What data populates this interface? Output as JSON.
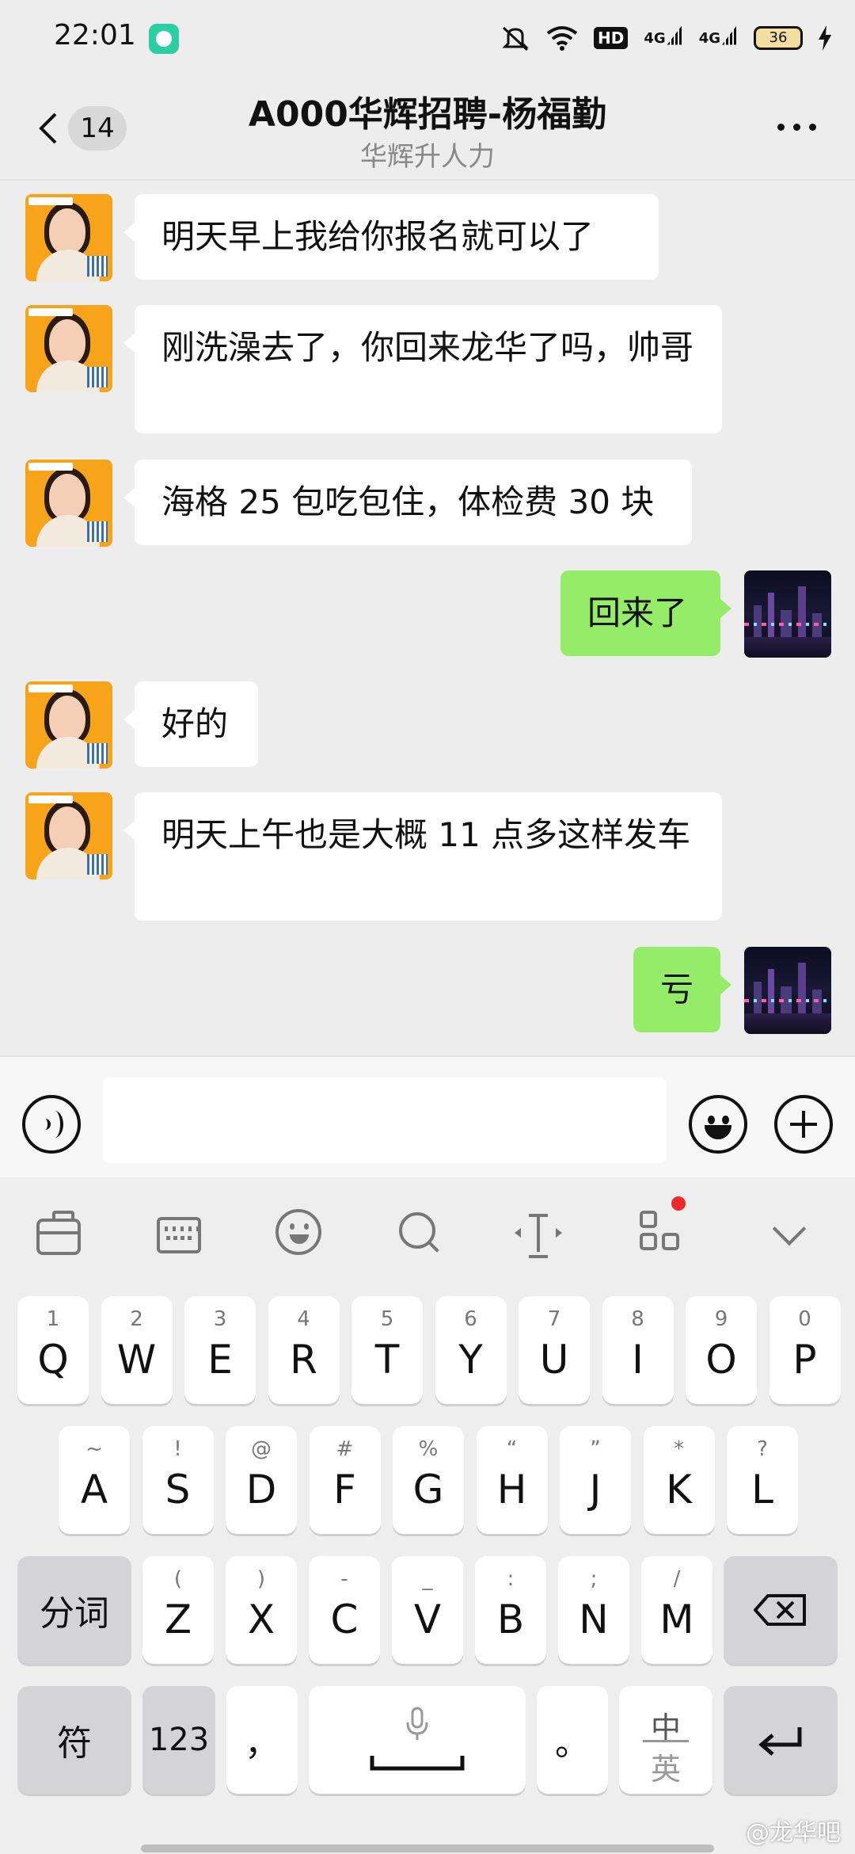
{
  "status_bar": {
    "time": "22:01",
    "hd": "HD",
    "net1": "4G",
    "net2": "4G",
    "battery": "36"
  },
  "header": {
    "unread_count": "14",
    "title": "A000华辉招聘-杨福勤",
    "subtitle": "华辉升人力"
  },
  "messages": [
    {
      "from": "recruiter",
      "text": "明天早上我给你报名就可以了"
    },
    {
      "from": "recruiter",
      "text": "刚洗澡去了，你回来龙华了吗，帅哥"
    },
    {
      "from": "recruiter",
      "text": "海格 25 包吃包住，体检费 30 块"
    },
    {
      "from": "self",
      "text": "回来了"
    },
    {
      "from": "recruiter",
      "text": "好的"
    },
    {
      "from": "recruiter",
      "text": "明天上午也是大概 11 点多这样发车"
    },
    {
      "from": "self",
      "text": "亏"
    }
  ],
  "input": {
    "value": "",
    "placeholder": ""
  },
  "keyboard": {
    "row1": [
      {
        "top": "1",
        "main": "Q"
      },
      {
        "top": "2",
        "main": "W"
      },
      {
        "top": "3",
        "main": "E"
      },
      {
        "top": "4",
        "main": "R"
      },
      {
        "top": "5",
        "main": "T"
      },
      {
        "top": "6",
        "main": "Y"
      },
      {
        "top": "7",
        "main": "U"
      },
      {
        "top": "8",
        "main": "I"
      },
      {
        "top": "9",
        "main": "O"
      },
      {
        "top": "0",
        "main": "P"
      }
    ],
    "row2": [
      {
        "top": "~",
        "main": "A"
      },
      {
        "top": "!",
        "main": "S"
      },
      {
        "top": "@",
        "main": "D"
      },
      {
        "top": "#",
        "main": "F"
      },
      {
        "top": "%",
        "main": "G"
      },
      {
        "top": "“",
        "main": "H"
      },
      {
        "top": "”",
        "main": "J"
      },
      {
        "top": "*",
        "main": "K"
      },
      {
        "top": "?",
        "main": "L"
      }
    ],
    "row3": [
      {
        "top": "(",
        "main": "Z"
      },
      {
        "top": ")",
        "main": "X"
      },
      {
        "top": "-",
        "main": "C"
      },
      {
        "top": "_",
        "main": "V"
      },
      {
        "top": ":",
        "main": "B"
      },
      {
        "top": ";",
        "main": "N"
      },
      {
        "top": "/",
        "main": "M"
      }
    ],
    "segment_label": "分词",
    "symbol_label": "符",
    "numeric_label": "123",
    "comma_label": "，",
    "period_label": "。",
    "lang_top": "中",
    "lang_bottom": "英"
  },
  "watermark": "@龙华吧",
  "colors": {
    "background": "#ededed",
    "incoming_bubble": "#ffffff",
    "outgoing_bubble": "#95ec69",
    "notification_dot": "#f0292d"
  },
  "icons": [
    "back-icon",
    "more-icon",
    "voice-icon",
    "emoji-icon",
    "plus-icon",
    "briefcase-icon",
    "keyboard-icon",
    "face-icon",
    "search-icon",
    "cursor-icon",
    "apps-icon",
    "chevron-down-icon",
    "mic-icon",
    "backspace-icon",
    "enter-icon"
  ]
}
